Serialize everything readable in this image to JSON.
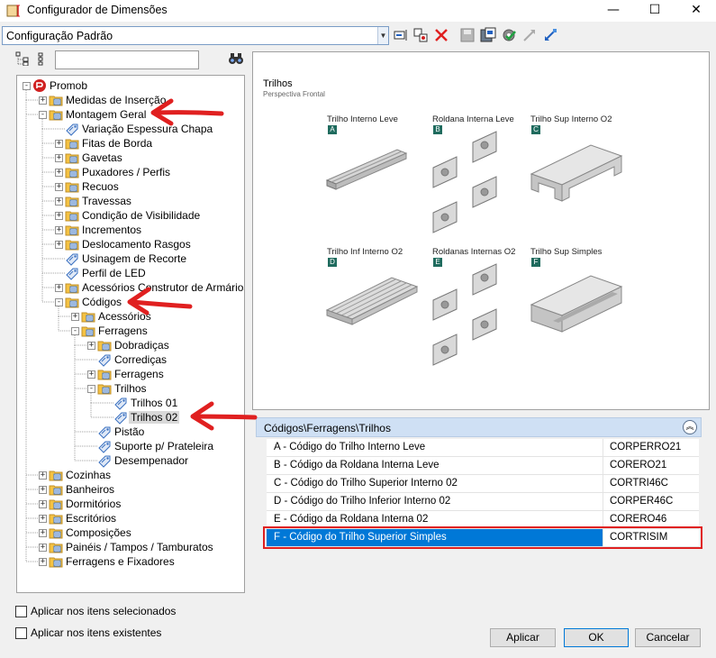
{
  "window": {
    "title": "Configurador de Dimensões",
    "minimize": "—",
    "maximize": "☐",
    "close": "✕"
  },
  "config_combo": {
    "value": "Configuração Padrão"
  },
  "tree": {
    "search_value": "",
    "nodes": [
      {
        "label": "Promob",
        "depth": 0,
        "expander": "minus",
        "icon": "promob-logo-icon"
      },
      {
        "label": "Medidas de Inserção",
        "depth": 1,
        "expander": "plus",
        "icon": "folder-icon"
      },
      {
        "label": "Montagem Geral",
        "depth": 1,
        "expander": "minus",
        "icon": "folder-icon"
      },
      {
        "label": "Variação Espessura Chapa",
        "depth": 2,
        "expander": "none",
        "icon": "tag-icon"
      },
      {
        "label": "Fitas de Borda",
        "depth": 2,
        "expander": "plus",
        "icon": "folder-icon"
      },
      {
        "label": "Gavetas",
        "depth": 2,
        "expander": "plus",
        "icon": "folder-icon"
      },
      {
        "label": "Puxadores / Perfis",
        "depth": 2,
        "expander": "plus",
        "icon": "folder-icon"
      },
      {
        "label": "Recuos",
        "depth": 2,
        "expander": "plus",
        "icon": "folder-icon"
      },
      {
        "label": "Travessas",
        "depth": 2,
        "expander": "plus",
        "icon": "folder-icon"
      },
      {
        "label": "Condição de Visibilidade",
        "depth": 2,
        "expander": "plus",
        "icon": "folder-icon"
      },
      {
        "label": "Incrementos",
        "depth": 2,
        "expander": "plus",
        "icon": "folder-icon"
      },
      {
        "label": "Deslocamento Rasgos",
        "depth": 2,
        "expander": "plus",
        "icon": "folder-icon"
      },
      {
        "label": "Usinagem de Recorte",
        "depth": 2,
        "expander": "none",
        "icon": "tag-icon"
      },
      {
        "label": "Perfil de LED",
        "depth": 2,
        "expander": "none",
        "icon": "tag-icon"
      },
      {
        "label": "Acessórios Construtor de Armários",
        "depth": 2,
        "expander": "plus",
        "icon": "folder-icon"
      },
      {
        "label": "Códigos",
        "depth": 2,
        "expander": "minus",
        "icon": "folder-icon"
      },
      {
        "label": "Acessórios",
        "depth": 3,
        "expander": "plus",
        "icon": "folder-icon"
      },
      {
        "label": "Ferragens",
        "depth": 3,
        "expander": "minus",
        "icon": "folder-icon"
      },
      {
        "label": "Dobradiças",
        "depth": 4,
        "expander": "plus",
        "icon": "folder-icon"
      },
      {
        "label": "Corrediças",
        "depth": 4,
        "expander": "none",
        "icon": "tag-icon"
      },
      {
        "label": "Ferragens",
        "depth": 4,
        "expander": "plus",
        "icon": "folder-icon"
      },
      {
        "label": "Trilhos",
        "depth": 4,
        "expander": "minus",
        "icon": "folder-icon"
      },
      {
        "label": "Trilhos 01",
        "depth": 5,
        "expander": "none",
        "icon": "tag-icon"
      },
      {
        "label": "Trilhos 02",
        "depth": 5,
        "expander": "none",
        "icon": "tag-icon",
        "selected": true
      },
      {
        "label": "Pistão",
        "depth": 4,
        "expander": "none",
        "icon": "tag-icon"
      },
      {
        "label": "Suporte p/ Prateleira",
        "depth": 4,
        "expander": "none",
        "icon": "tag-icon"
      },
      {
        "label": "Desempenador",
        "depth": 4,
        "expander": "none",
        "icon": "tag-icon"
      },
      {
        "label": "Cozinhas",
        "depth": 1,
        "expander": "plus",
        "icon": "folder-icon"
      },
      {
        "label": "Banheiros",
        "depth": 1,
        "expander": "plus",
        "icon": "folder-icon"
      },
      {
        "label": "Dormitórios",
        "depth": 1,
        "expander": "plus",
        "icon": "folder-icon"
      },
      {
        "label": "Escritórios",
        "depth": 1,
        "expander": "plus",
        "icon": "folder-icon"
      },
      {
        "label": "Composições",
        "depth": 1,
        "expander": "plus",
        "icon": "folder-icon"
      },
      {
        "label": "Painéis / Tampos / Tamburatos",
        "depth": 1,
        "expander": "plus",
        "icon": "folder-icon"
      },
      {
        "label": "Ferragens e Fixadores",
        "depth": 1,
        "expander": "plus",
        "icon": "folder-icon"
      }
    ]
  },
  "preview": {
    "title": "Trilhos",
    "subtitle": "Perspectiva Frontal",
    "parts": [
      {
        "letter": "A",
        "label": "Trilho Interno Leve"
      },
      {
        "letter": "B",
        "label": "Roldana Interna Leve"
      },
      {
        "letter": "C",
        "label": "Trilho Sup Interno O2"
      },
      {
        "letter": "D",
        "label": "Trilho Inf Interno O2"
      },
      {
        "letter": "E",
        "label": "Roldanas Internas O2"
      },
      {
        "letter": "F",
        "label": "Trilho Sup Simples"
      }
    ]
  },
  "grid": {
    "path": "Códigos\\Ferragens\\Trilhos",
    "collapse_glyph": "︽",
    "rows": [
      {
        "name": "A - Código do Trilho Interno Leve",
        "value": "CORPERRO21"
      },
      {
        "name": "B - Código da Roldana Interna Leve",
        "value": "CORERO21"
      },
      {
        "name": "C - Código do Trilho Superior Interno 02",
        "value": "CORTRI46C"
      },
      {
        "name": "D - Código do Trilho Inferior Interno 02",
        "value": "CORPER46C"
      },
      {
        "name": "E - Código da Roldana Interna 02",
        "value": "CORERO46"
      },
      {
        "name": "F - Código do Trilho Superior Simples",
        "value": "CORTRISIM",
        "selected": true
      }
    ]
  },
  "options": {
    "apply_selected": "Aplicar nos itens selecionados",
    "apply_existing": "Aplicar nos itens existentes"
  },
  "buttons": {
    "apply": "Aplicar",
    "ok": "OK",
    "cancel": "Cancelar"
  },
  "colors": {
    "accent": "#0078d7",
    "annotation_red": "#e02020",
    "folder_yellow": "#f5c242",
    "part_letter_green": "#1f6b5e"
  }
}
